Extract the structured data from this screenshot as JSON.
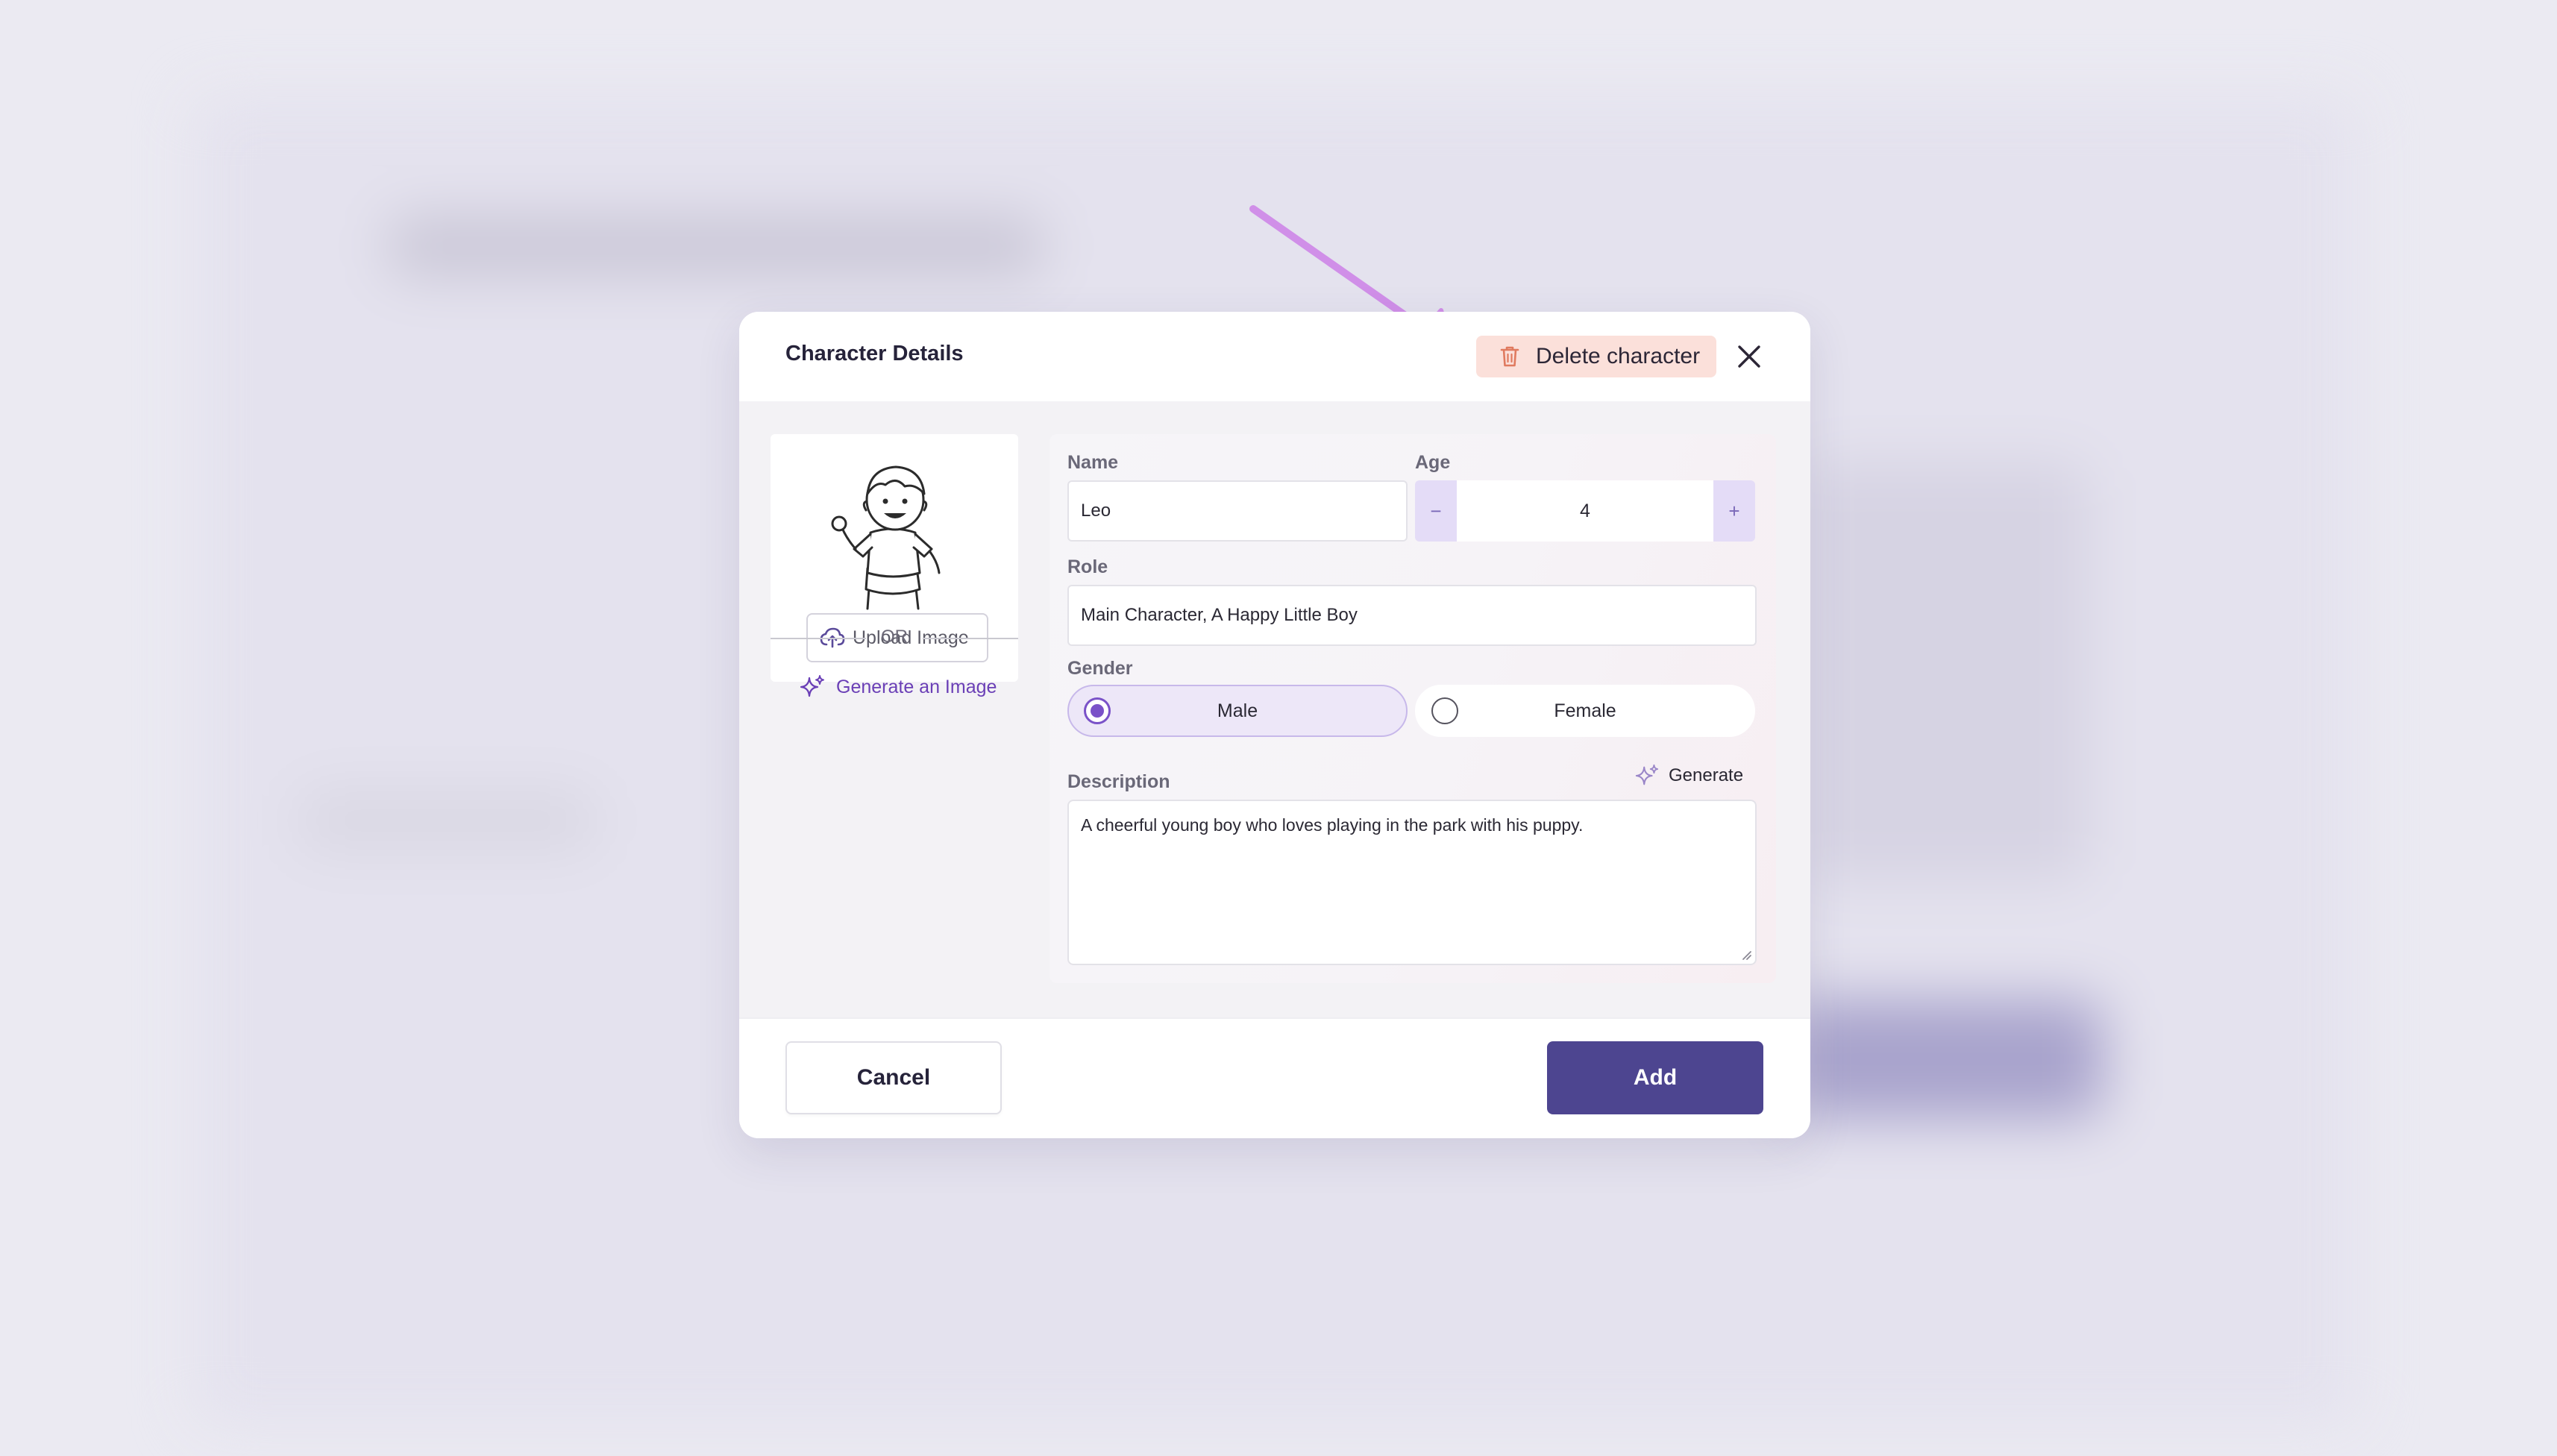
{
  "modal": {
    "title": "Character Details",
    "delete_label": "Delete character"
  },
  "image_panel": {
    "upload_label": "Upload Image",
    "or_text": "OR",
    "generate_image_label": "Generate an Image"
  },
  "form": {
    "name_label": "Name",
    "name_value": "Leo",
    "age_label": "Age",
    "age_value": "4",
    "age_decrement": "−",
    "age_increment": "+",
    "role_label": "Role",
    "role_value": "Main Character, A Happy Little Boy",
    "gender_label": "Gender",
    "gender_options": [
      {
        "label": "Male",
        "selected": true
      },
      {
        "label": "Female",
        "selected": false
      }
    ],
    "description_label": "Description",
    "generate_label": "Generate",
    "description_value": "A cheerful young boy who loves playing in the park with his puppy."
  },
  "footer": {
    "cancel_label": "Cancel",
    "add_label": "Add"
  },
  "colors": {
    "accent": "#4d4590",
    "accent_light": "#e4dcf7",
    "radio_selected": "#7a52c8",
    "delete_bg": "#fbe0da",
    "delete_icon": "#e07a5f",
    "arrow": "#d08fe8"
  },
  "icons": [
    "trash-icon",
    "close-icon",
    "cloud-upload-icon",
    "sparkle-icon",
    "resize-handle-icon"
  ]
}
